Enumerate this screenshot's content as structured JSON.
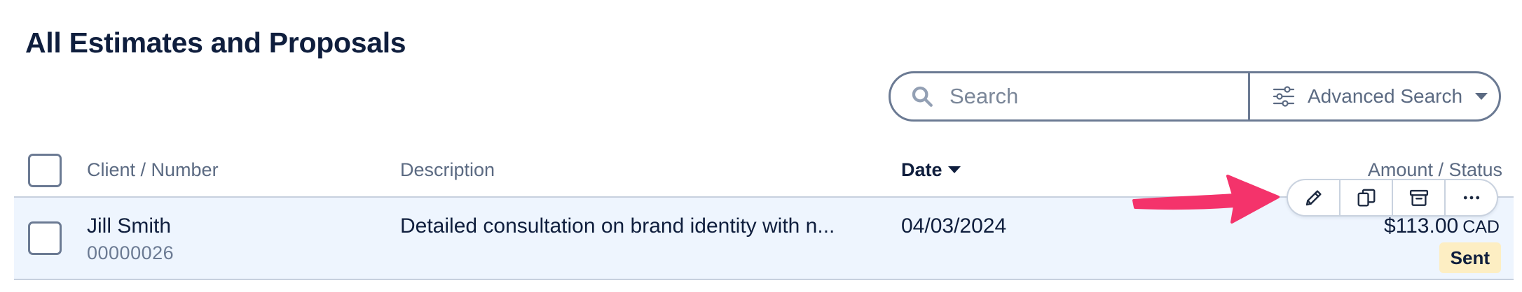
{
  "page": {
    "title": "All Estimates and Proposals"
  },
  "search": {
    "placeholder": "Search",
    "value": "",
    "advanced_label": "Advanced Search"
  },
  "table": {
    "columns": {
      "client": "Client / Number",
      "description": "Description",
      "date": "Date",
      "amount_status": "Amount / Status"
    },
    "sort_column": "date",
    "rows": [
      {
        "client": "Jill Smith",
        "number": "00000026",
        "description": "Detailed consultation on brand identity with n...",
        "date": "04/03/2024",
        "amount": "$113.00",
        "currency": "CAD",
        "status": "Sent"
      }
    ]
  },
  "row_actions": [
    {
      "name": "edit",
      "icon": "pencil-icon"
    },
    {
      "name": "duplicate",
      "icon": "copy-icon"
    },
    {
      "name": "archive",
      "icon": "archive-icon"
    },
    {
      "name": "more",
      "icon": "more-icon"
    }
  ],
  "colors": {
    "text_primary": "#0f1e3d",
    "text_secondary": "#5b6a82",
    "border": "#6b7a93",
    "row_hover_bg": "#eef5fe",
    "status_sent_bg": "#fdeec3",
    "annotation_arrow": "#f4336b"
  }
}
